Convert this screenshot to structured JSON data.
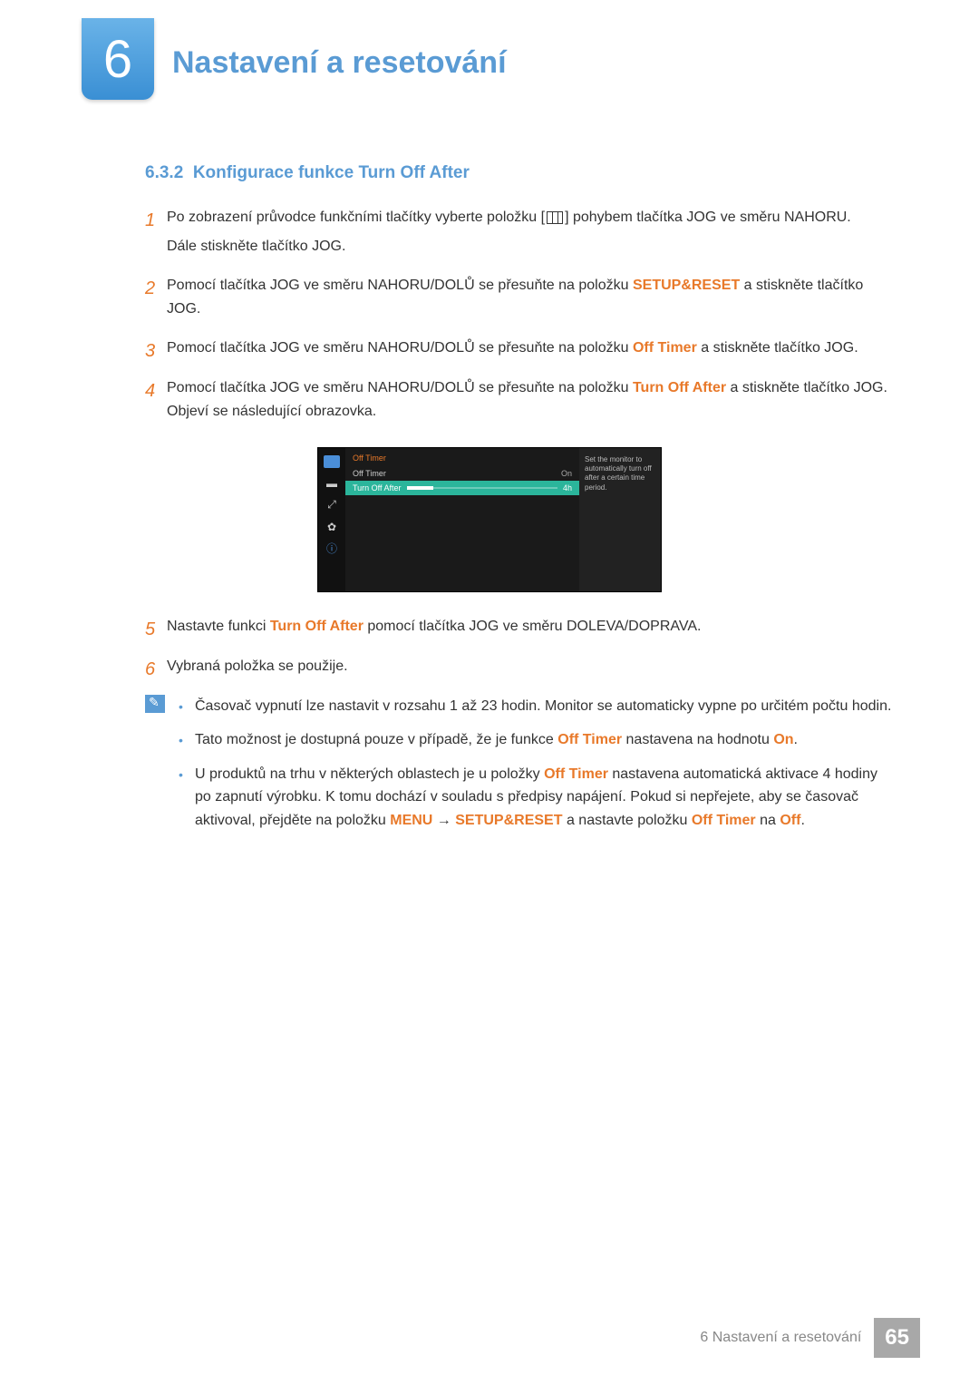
{
  "chapter": {
    "number": "6",
    "title": "Nastavení a resetování"
  },
  "section": {
    "number": "6.3.2",
    "title": "Konfigurace funkce Turn Off After"
  },
  "steps": [
    {
      "num": "1",
      "text_a": "Po zobrazení průvodce funkčními tlačítky vyberte položku [",
      "text_b": "] pohybem tlačítka JOG ve směru NAHORU.",
      "text_c": "Dále stiskněte tlačítko JOG."
    },
    {
      "num": "2",
      "text_a": "Pomocí tlačítka JOG ve směru NAHORU/DOLŮ se přesuňte na položku ",
      "bold": "SETUP&RESET",
      "text_b": " a stiskněte tlačítko JOG."
    },
    {
      "num": "3",
      "text_a": "Pomocí tlačítka JOG ve směru NAHORU/DOLŮ se přesuňte na položku ",
      "bold": "Off Timer",
      "text_b": " a stiskněte tlačítko JOG."
    },
    {
      "num": "4",
      "text_a": "Pomocí tlačítka JOG ve směru NAHORU/DOLŮ se přesuňte na položku ",
      "bold": "Turn Off After",
      "text_b": " a stiskněte tlačítko JOG. Objeví se následující obrazovka."
    },
    {
      "num": "5",
      "text_a": "Nastavte funkci ",
      "bold": "Turn Off After",
      "text_b": " pomocí tlačítka JOG ve směru DOLEVA/DOPRAVA."
    },
    {
      "num": "6",
      "text_a": "Vybraná položka se použije."
    }
  ],
  "osd": {
    "header": "Off Timer",
    "row1_label": "Off Timer",
    "row1_value": "On",
    "row2_label": "Turn Off After",
    "row2_value": "4h",
    "info": "Set the monitor to automatically turn off after a certain time period."
  },
  "notes": [
    {
      "text": "Časovač vypnutí lze nastavit v rozsahu 1 až 23 hodin. Monitor se automaticky vypne po určitém počtu hodin."
    },
    {
      "text_a": "Tato možnost je dostupná pouze v případě, že je funkce ",
      "bold1": "Off Timer",
      "text_b": " nastavena na hodnotu ",
      "bold2": "On",
      "text_c": "."
    },
    {
      "text_a": "U produktů na trhu v některých oblastech je u položky ",
      "bold1": "Off Timer",
      "text_b": " nastavena automatická aktivace 4 hodiny po zapnutí výrobku. K tomu dochází v souladu s předpisy napájení. Pokud si nepřejete, aby se časovač aktivoval, přejděte na položku ",
      "bold2": "MENU",
      "arrow": " → ",
      "bold3": "SETUP&RESET",
      "text_c": " a nastavte položku ",
      "bold4": "Off Timer",
      "text_d": " na ",
      "bold5": "Off",
      "text_e": "."
    }
  ],
  "footer": {
    "text": "6 Nastavení a resetování",
    "page": "65"
  }
}
